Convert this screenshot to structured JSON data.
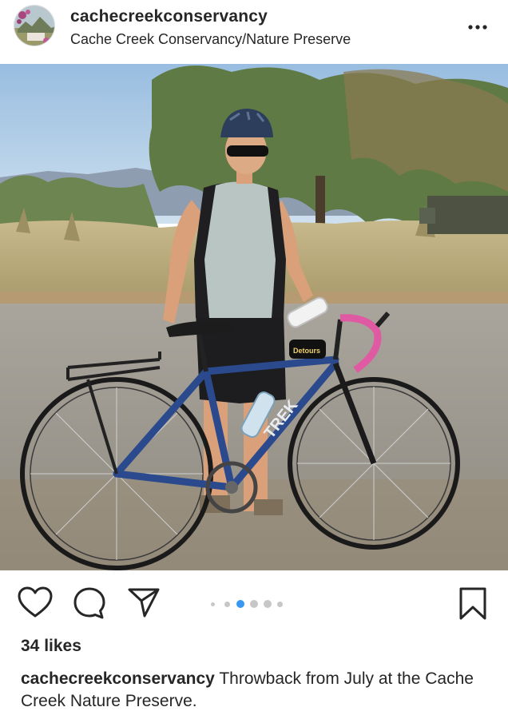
{
  "post": {
    "username": "cachecreekconservancy",
    "location": "Cache Creek Conservancy/Nature Preserve",
    "likes": "34 likes",
    "caption_user": "cachecreekconservancy",
    "caption_text": "Throwback from July at the Cache Creek Nature Preserve."
  },
  "icons": {
    "more": "more-options-icon",
    "like": "heart-icon",
    "comment": "comment-icon",
    "share": "send-icon",
    "save": "bookmark-icon"
  },
  "carousel": {
    "count": 6,
    "active_index": 2
  },
  "colors": {
    "active_dot": "#3897f0",
    "inactive_dot": "#c7c7c7",
    "text": "#262626"
  },
  "photo_texts": {
    "frame_brand": "TREK",
    "bag_brand": "Detours"
  }
}
